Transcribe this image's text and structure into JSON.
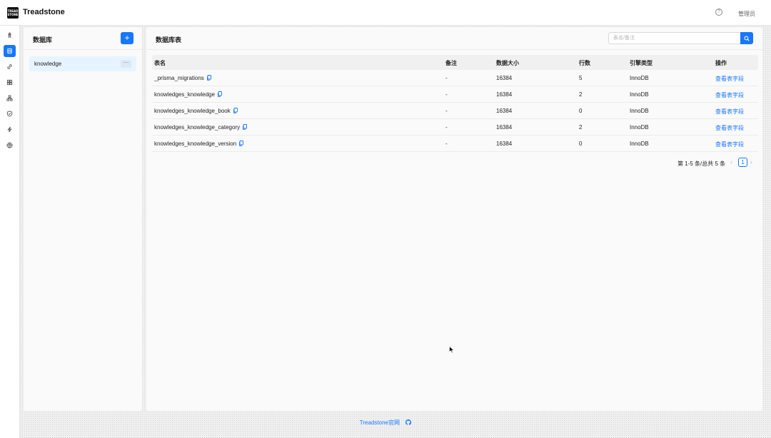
{
  "header": {
    "logo_text": "TREAD STONE",
    "app_title": "Treadstone",
    "help_icon": "question-circle-icon",
    "user_label": "管理员"
  },
  "sidenav": {
    "items": [
      {
        "icon": "rocket-icon",
        "active": false
      },
      {
        "icon": "database-icon",
        "active": true
      },
      {
        "icon": "link-icon",
        "active": false
      },
      {
        "icon": "appstore-icon",
        "active": false
      },
      {
        "icon": "cluster-icon",
        "active": false
      },
      {
        "icon": "shield-icon",
        "active": false
      },
      {
        "icon": "thunderbolt-icon",
        "active": false
      },
      {
        "icon": "setting-icon",
        "active": false
      }
    ]
  },
  "db_panel": {
    "title": "数据库",
    "add_label": "+",
    "databases": [
      {
        "name": "knowledge",
        "more": "···"
      }
    ]
  },
  "table_panel": {
    "title": "数据库表",
    "search_placeholder": "表名/备注",
    "columns": [
      "表名",
      "备注",
      "数据大小",
      "行数",
      "引擎类型",
      "操作"
    ],
    "rows": [
      {
        "name": "_prisma_migrations",
        "remark": "-",
        "size": "16384",
        "rows": "5",
        "engine": "InnoDB",
        "action": "查看表字段"
      },
      {
        "name": "knowledges_knowledge",
        "remark": "-",
        "size": "16384",
        "rows": "2",
        "engine": "InnoDB",
        "action": "查看表字段"
      },
      {
        "name": "knowledges_knowledge_book",
        "remark": "-",
        "size": "16384",
        "rows": "0",
        "engine": "InnoDB",
        "action": "查看表字段"
      },
      {
        "name": "knowledges_knowledge_category",
        "remark": "-",
        "size": "16384",
        "rows": "2",
        "engine": "InnoDB",
        "action": "查看表字段"
      },
      {
        "name": "knowledges_knowledge_version",
        "remark": "-",
        "size": "16384",
        "rows": "0",
        "engine": "InnoDB",
        "action": "查看表字段"
      }
    ],
    "pagination": {
      "summary": "第 1-5 条/总共 5 条",
      "current_page": "1",
      "prev": "‹",
      "next": "›"
    }
  },
  "footer": {
    "link_text": "Treadstone官网",
    "icon": "github-icon"
  },
  "colors": {
    "primary": "#1677ff",
    "selected_bg": "#e6f4ff"
  }
}
